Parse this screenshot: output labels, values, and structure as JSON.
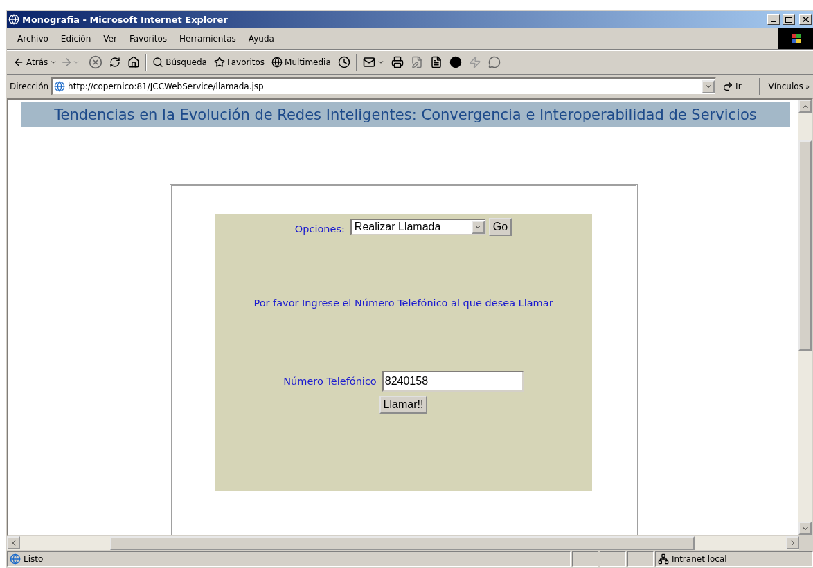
{
  "window": {
    "title": "Monografia - Microsoft Internet Explorer"
  },
  "menu": [
    "Archivo",
    "Edición",
    "Ver",
    "Favoritos",
    "Herramientas",
    "Ayuda"
  ],
  "toolbar": {
    "back": "Atrás",
    "search": "Búsqueda",
    "favorites": "Favoritos",
    "media": "Multimedia"
  },
  "address": {
    "label": "Dirección",
    "url": "http://copernico:81/JCCWebService/llamada.jsp",
    "go": "Ir",
    "links": "Vínculos",
    "more": "»"
  },
  "page": {
    "heading": "Tendencias en la Evolución de Redes Inteligentes: Convergencia e Interoperabilidad de Servicios",
    "options_label": "Opciones:",
    "option": "Realizar Llamada",
    "go": "Go",
    "message": "Por favor Ingrese el Número Telefónico al que desea Llamar",
    "phone_label": "Número Telefónico",
    "phone_value": "8240158",
    "call": "Llamar!!"
  },
  "status": {
    "text": "Listo",
    "zone": "Intranet local"
  }
}
